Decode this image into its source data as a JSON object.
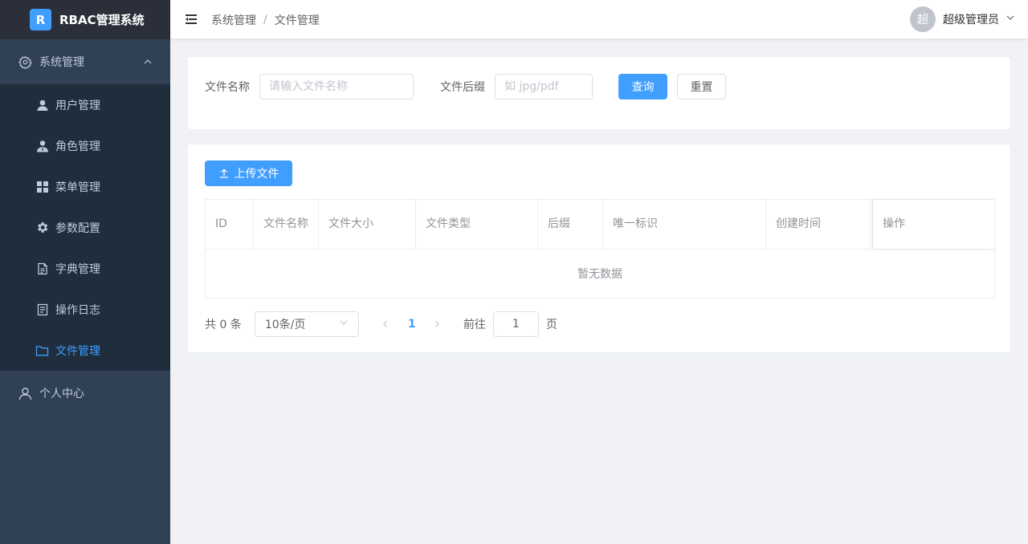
{
  "app": {
    "logo_letter": "R",
    "title": "RBAC管理系统"
  },
  "sidebar": {
    "group_label": "系统管理",
    "items": [
      {
        "label": "用户管理",
        "icon": "user-icon"
      },
      {
        "label": "角色管理",
        "icon": "role-icon"
      },
      {
        "label": "菜单管理",
        "icon": "grid-icon"
      },
      {
        "label": "参数配置",
        "icon": "gear-icon"
      },
      {
        "label": "字典管理",
        "icon": "document-icon"
      },
      {
        "label": "操作日志",
        "icon": "log-icon"
      },
      {
        "label": "文件管理",
        "icon": "folder-icon",
        "active": true
      }
    ],
    "personal_label": "个人中心"
  },
  "header": {
    "breadcrumb": [
      "系统管理",
      "文件管理"
    ],
    "breadcrumb_separator": "/",
    "avatar_text": "超",
    "user_name": "超级管理员"
  },
  "search": {
    "name_label": "文件名称",
    "name_placeholder": "请输入文件名称",
    "suffix_label": "文件后缀",
    "suffix_placeholder": "如 jpg/pdf",
    "query_button": "查询",
    "reset_button": "重置"
  },
  "table": {
    "upload_button": "上传文件",
    "columns": [
      "ID",
      "文件名称",
      "文件大小",
      "文件类型",
      "后缀",
      "唯一标识",
      "创建时间",
      "操作"
    ],
    "empty_text": "暂无数据"
  },
  "pagination": {
    "total_text": "共 0 条",
    "page_size": "10条/页",
    "current_page": "1",
    "goto_label": "前往",
    "goto_value": "1",
    "page_unit": "页"
  },
  "colors": {
    "sidebar_bg": "#304156",
    "logo_bg": "#2b2f3a",
    "accent": "#409eff"
  }
}
